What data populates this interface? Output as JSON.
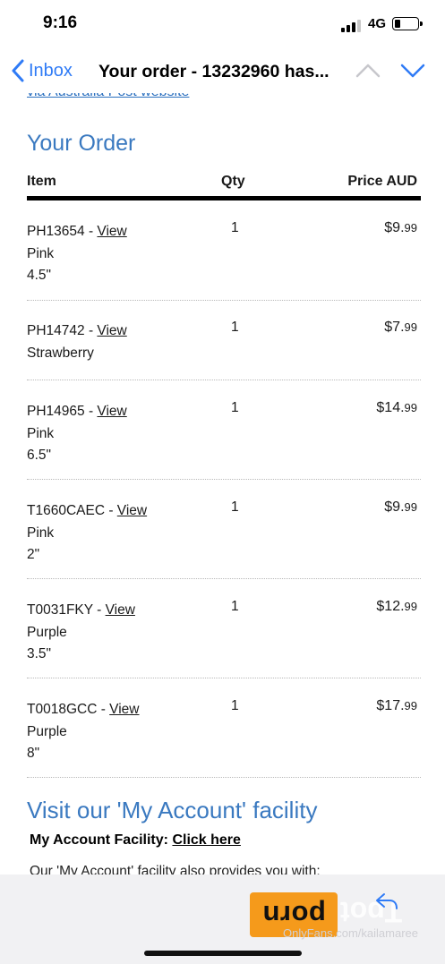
{
  "status": {
    "time": "9:16",
    "network": "4G",
    "battery_level": 0.25
  },
  "nav": {
    "back_label": "Inbox",
    "title": "Your order - 13232960 has..."
  },
  "email": {
    "cut_link": "via Australia Post website",
    "order_title": "Your Order",
    "headers": {
      "item": "Item",
      "qty": "Qty",
      "price": "Price AUD"
    },
    "view_label": "View",
    "items": [
      {
        "code": "PH13654 - ",
        "line2": "Pink",
        "line3": "4.5\"",
        "qty": "1",
        "price_main": "$9.",
        "price_cents": "99"
      },
      {
        "code": "PH14742 - ",
        "line2": "Strawberry",
        "line3": "",
        "qty": "1",
        "price_main": "$7.",
        "price_cents": "99"
      },
      {
        "code": "PH14965 - ",
        "line2": "Pink",
        "line3": "6.5\"",
        "qty": "1",
        "price_main": "$14.",
        "price_cents": "99"
      },
      {
        "code": "T1660CAEC - ",
        "line2": "Pink",
        "line3": "2\"",
        "qty": "1",
        "price_main": "$9.",
        "price_cents": "99"
      },
      {
        "code": "T0031FKY - ",
        "line2": "Purple",
        "line3": "3.5\"",
        "qty": "1",
        "price_main": "$12.",
        "price_cents": "99"
      },
      {
        "code": "T0018GCC - ",
        "line2": "Purple",
        "line3": "8\"",
        "qty": "1",
        "price_main": "$17.",
        "price_cents": "99"
      }
    ],
    "account_title": "Visit our 'My Account' facility",
    "account_label": "My Account Facility: ",
    "account_link": "Click here",
    "account_desc": "Our 'My Account' facility also provides you with:"
  },
  "toolbar": {
    "logo_text": "porn",
    "ghost_text": "Tpot",
    "watermark": "OnlyFans.com/kailamaree"
  },
  "colors": {
    "accent": "#2f7bf6",
    "heading_blue": "#3a79c0",
    "logo_orange": "#f59a1b"
  }
}
